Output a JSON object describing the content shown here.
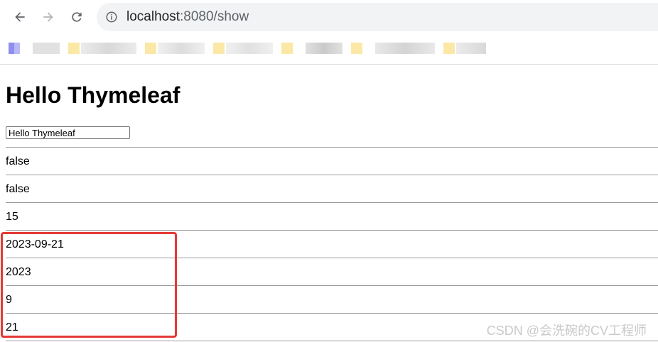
{
  "browser": {
    "url_host": "localhost",
    "url_rest": ":8080/show"
  },
  "page": {
    "heading": "Hello Thymeleaf",
    "input_value": "Hello Thymeleaf",
    "rows": [
      "false",
      "false",
      "15",
      "2023-09-21",
      "2023",
      "9",
      "21"
    ]
  },
  "watermark": "CSDN @会洗碗的CV工程师",
  "colors": {
    "highlight_border": "#e53935",
    "omnibox_bg": "#f1f3f4"
  }
}
